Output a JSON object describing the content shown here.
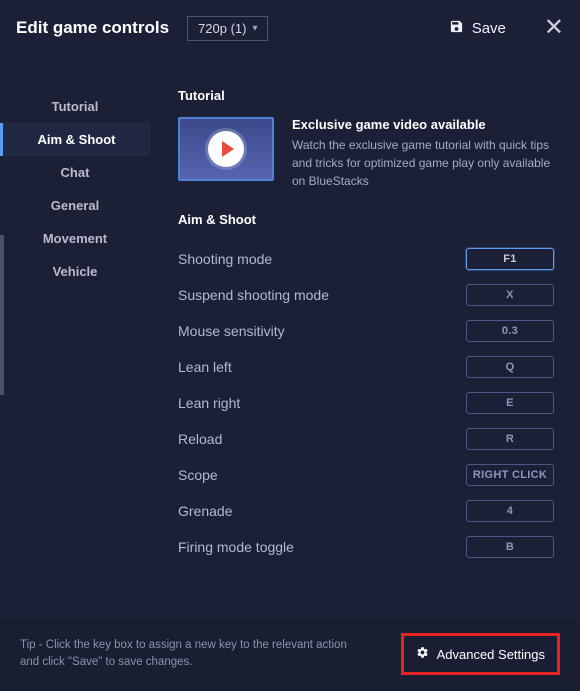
{
  "header": {
    "title": "Edit game controls",
    "dropdown_label": "720p (1)",
    "save_label": "Save"
  },
  "sidebar": {
    "items": [
      {
        "label": "Tutorial"
      },
      {
        "label": "Aim & Shoot"
      },
      {
        "label": "Chat"
      },
      {
        "label": "General"
      },
      {
        "label": "Movement"
      },
      {
        "label": "Vehicle"
      }
    ]
  },
  "tutorial": {
    "heading": "Tutorial",
    "title": "Exclusive game video available",
    "desc": "Watch the exclusive game tutorial with quick tips and tricks for optimized game play only available on BlueStacks"
  },
  "aim_shoot": {
    "heading": "Aim & Shoot",
    "rows": [
      {
        "label": "Shooting mode",
        "key": "F1",
        "focused": true
      },
      {
        "label": "Suspend shooting mode",
        "key": "X"
      },
      {
        "label": "Mouse sensitivity",
        "key": "0.3"
      },
      {
        "label": "Lean left",
        "key": "Q"
      },
      {
        "label": "Lean right",
        "key": "E"
      },
      {
        "label": "Reload",
        "key": "R"
      },
      {
        "label": "Scope",
        "key": "RIGHT CLICK"
      },
      {
        "label": "Grenade",
        "key": "4"
      },
      {
        "label": "Firing mode toggle",
        "key": "B"
      }
    ]
  },
  "footer": {
    "tip": "Tip - Click the key box to assign a new key to the relevant action and click \"Save\" to save changes.",
    "advanced_label": "Advanced Settings"
  }
}
